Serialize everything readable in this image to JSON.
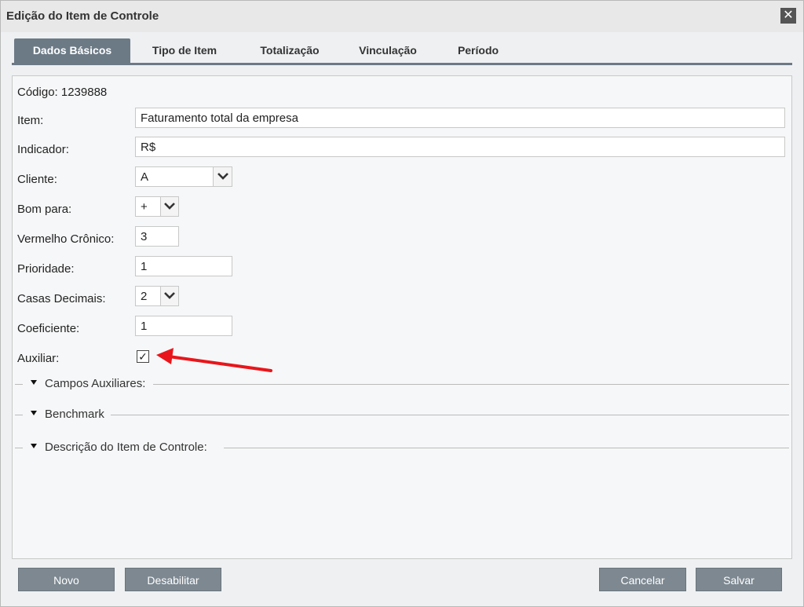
{
  "window": {
    "title": "Edição do Item de Controle",
    "close_glyph": "✕"
  },
  "tabs": [
    {
      "label": "Dados Básicos",
      "active": true
    },
    {
      "label": "Tipo de Item",
      "active": false
    },
    {
      "label": "Totalização",
      "active": false
    },
    {
      "label": "Vinculação",
      "active": false
    },
    {
      "label": "Período",
      "active": false
    }
  ],
  "form": {
    "codigo": "Código: 1239888",
    "item": {
      "label": "Item:",
      "value": "Faturamento total da empresa"
    },
    "indicador": {
      "label": "Indicador:",
      "value": "R$"
    },
    "cliente": {
      "label": "Cliente:",
      "value": "A"
    },
    "bom_para": {
      "label": "Bom para:",
      "value": "+"
    },
    "vermelho_cronico": {
      "label": "Vermelho Crônico:",
      "value": "3"
    },
    "prioridade": {
      "label": "Prioridade:",
      "value": "1"
    },
    "casas_decimais": {
      "label": "Casas Decimais:",
      "value": "2"
    },
    "coeficiente": {
      "label": "Coeficiente:",
      "value": "1"
    },
    "auxiliar": {
      "label": "Auxiliar:",
      "checked": true,
      "check_glyph": "✓"
    }
  },
  "sections": [
    {
      "title": "Campos Auxiliares:"
    },
    {
      "title": "Benchmark"
    },
    {
      "title": "Descrição do Item de Controle:"
    }
  ],
  "buttons": {
    "novo": "Novo",
    "desabilitar": "Desabilitar",
    "cancelar": "Cancelar",
    "salvar": "Salvar"
  },
  "colors": {
    "accent": "#6c7a86",
    "button": "#7d8891",
    "annotation_arrow": "#e8161b"
  },
  "icons": [
    "close-icon",
    "chevron-down-icon",
    "checkbox-check-icon",
    "caret-down-icon",
    "annotation-arrow"
  ]
}
